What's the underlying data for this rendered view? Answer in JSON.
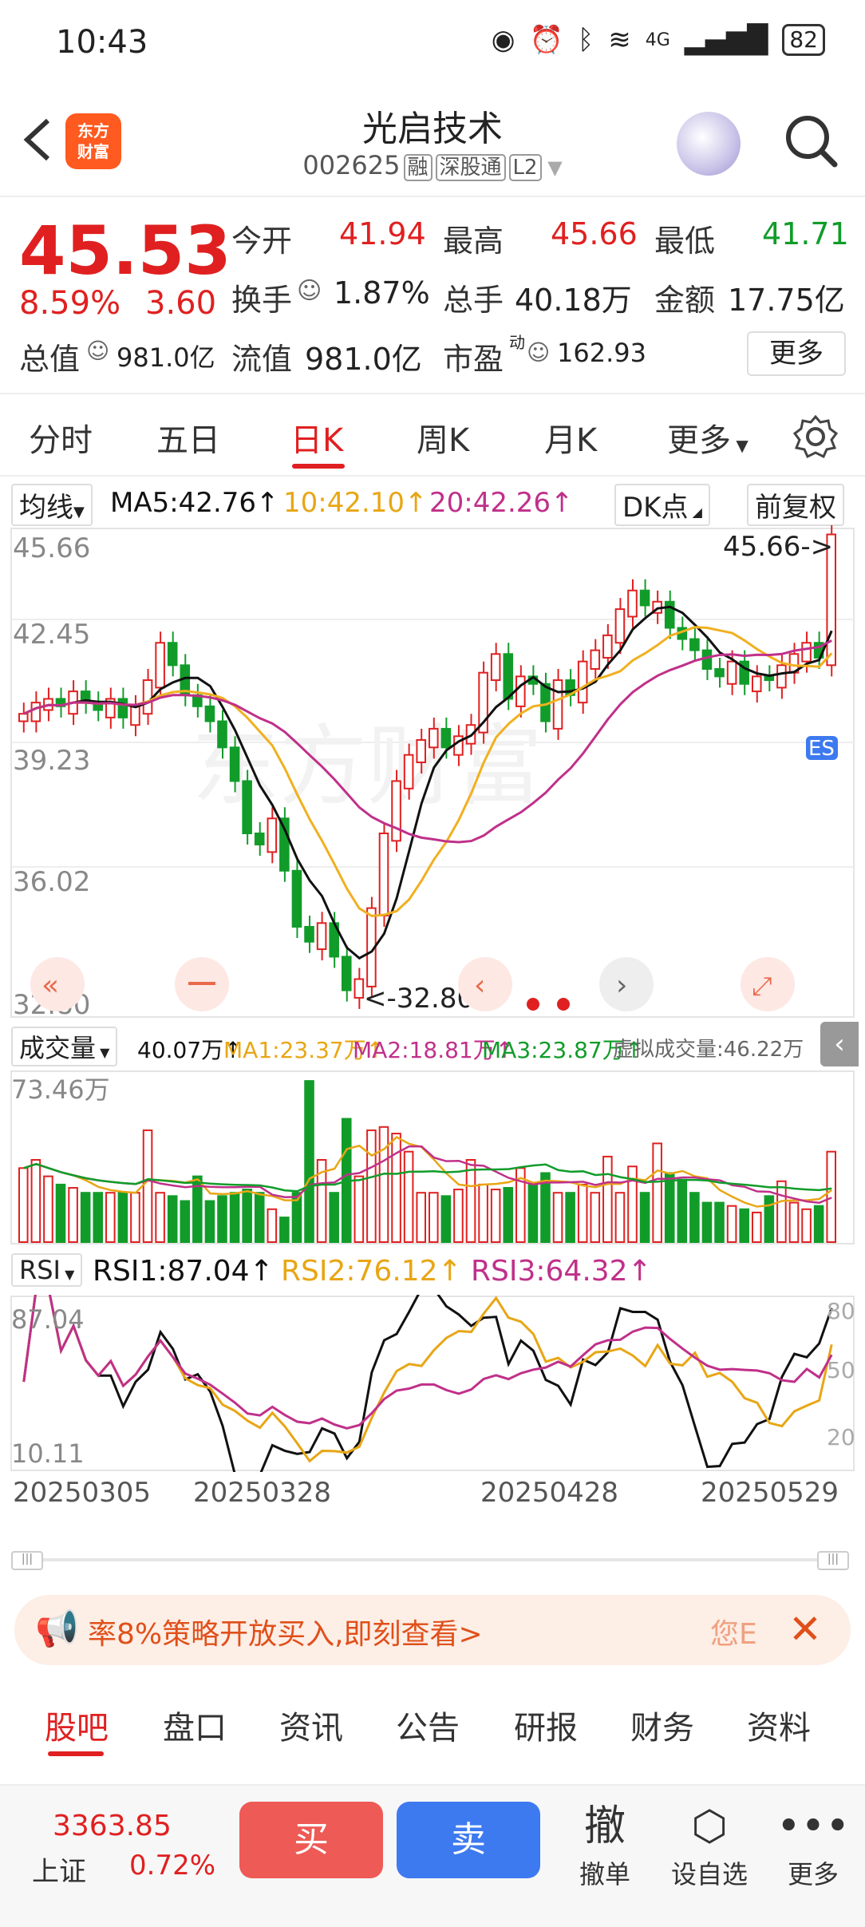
{
  "status": {
    "time": "10:43",
    "battery": "82",
    "net": "4G"
  },
  "header": {
    "logo_line1": "东方",
    "logo_line2": "财富",
    "name": "光启技术",
    "code": "002625",
    "tags": [
      "融",
      "深股通",
      "L2"
    ]
  },
  "quote": {
    "price": "45.53",
    "pct": "8.59%",
    "chg": "3.60",
    "rows": [
      [
        {
          "label": "今开",
          "value": "41.94",
          "color": "red"
        },
        {
          "label": "最高",
          "value": "45.66",
          "color": "red"
        },
        {
          "label": "最低",
          "value": "41.71",
          "color": "green"
        }
      ],
      [
        {
          "label": "换手",
          "value": "1.87%",
          "color": "dark"
        },
        {
          "label": "总手",
          "value": "40.18万",
          "color": "dark"
        },
        {
          "label": "金额",
          "value": "17.75亿",
          "color": "dark"
        }
      ],
      [
        {
          "label": "总值",
          "value": "981.0亿",
          "color": "dark"
        },
        {
          "label": "流值",
          "value": "981.0亿",
          "color": "dark"
        },
        {
          "label": "市盈",
          "value": "162.93",
          "color": "dark"
        }
      ]
    ],
    "pe_sup": "动",
    "more_label": "更多"
  },
  "tabs": [
    "分时",
    "五日",
    "日K",
    "周K",
    "月K",
    "更多"
  ],
  "active_tab": "日K",
  "ma": {
    "selector": "均线",
    "ma5": "MA5:42.76↑",
    "ma10": "10:42.10↑",
    "ma20": "20:42.26↑",
    "dk": "DK点",
    "adjust": "前复权"
  },
  "kline": {
    "price_labels": [
      "45.66",
      "42.45",
      "39.23",
      "36.02",
      "32.80"
    ],
    "high_marker": "45.66->",
    "low_marker": "<-32.80",
    "watermark": "东方财富",
    "es_label": "ES"
  },
  "volume": {
    "selector": "成交量",
    "vol": "40.07万↑",
    "ma1": "MA1:23.37万↑",
    "ma2": "MA2:18.81万↑",
    "ma3": "MA3:23.87万↑",
    "virtual": "虚拟成交量:46.22万",
    "max_label": "73.46万"
  },
  "rsi": {
    "selector": "RSI",
    "rsi1": "RSI1:87.04↑",
    "rsi2": "RSI2:76.12↑",
    "rsi3": "RSI3:64.32↑",
    "top": "87.04",
    "bottom": "10.11",
    "right_labels": [
      "80",
      "50",
      "20"
    ]
  },
  "dates": [
    "20250305",
    "20250328",
    "20250428",
    "20250529"
  ],
  "banner": {
    "text": "率8%策略开放买入,即刻查看>",
    "tail": "您E"
  },
  "bottom_tabs": [
    "股吧",
    "盘口",
    "资讯",
    "公告",
    "研报",
    "财务",
    "资料"
  ],
  "toolbar": {
    "index_value": "3363.85",
    "index_name": "上证",
    "index_pct": "0.72%",
    "buy": "买",
    "sell": "卖",
    "cancel_icon": "撤",
    "cancel": "撤单",
    "watch": "设自选",
    "more": "更多"
  },
  "colors": {
    "up": "#e02020",
    "down": "#119c2a",
    "ma5": "#111111",
    "ma10": "#f0b020",
    "ma20": "#c0308a"
  }
}
